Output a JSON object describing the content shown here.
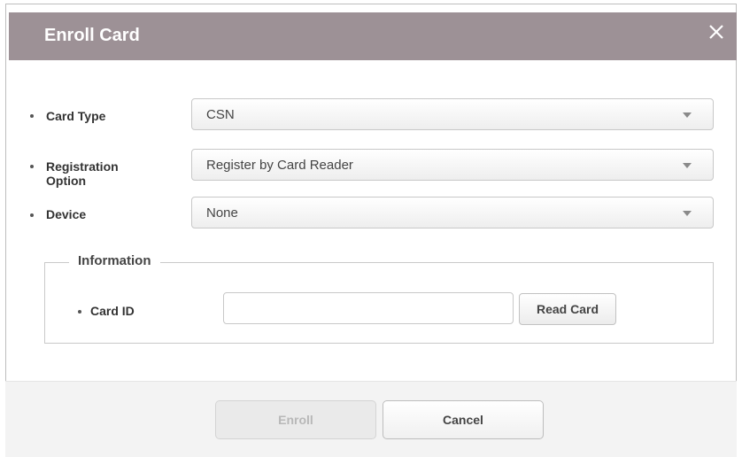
{
  "dialog": {
    "title": "Enroll Card",
    "header_color": "#9d9196"
  },
  "form": {
    "card_type": {
      "label": "Card Type",
      "value": "CSN"
    },
    "registration_option": {
      "label_line1": "Registration",
      "label_line2": "Option",
      "value": "Register by Card Reader"
    },
    "device": {
      "label": "Device",
      "value": "None"
    }
  },
  "information": {
    "legend": "Information",
    "card_id": {
      "label": "Card ID",
      "value": "",
      "placeholder": ""
    },
    "read_card_label": "Read Card"
  },
  "footer": {
    "enroll_label": "Enroll",
    "enroll_disabled": true,
    "cancel_label": "Cancel"
  },
  "icons": {
    "close": "close-icon",
    "dropdown": "chevron-down-icon"
  }
}
